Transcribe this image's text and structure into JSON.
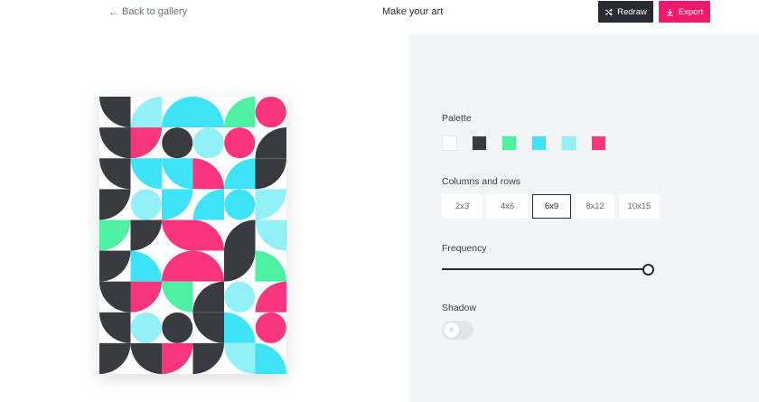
{
  "header": {
    "back_label": "Back to gallery",
    "title": "Make your art",
    "redraw_label": "Redraw",
    "export_label": "Export"
  },
  "colors": {
    "dark": "#3a3b40",
    "cyan": "#3ee3f7",
    "light_cyan": "#93f0f7",
    "pink": "#f8357d",
    "green": "#4ff0a3",
    "white": "#ffffff",
    "export_bg": "#f0196b",
    "redraw_bg": "#2a2b30"
  },
  "panel": {
    "palette_label": "Palette",
    "palette": [
      {
        "name": "white",
        "color": "#ffffff"
      },
      {
        "name": "dark",
        "color": "#3a3b40"
      },
      {
        "name": "green",
        "color": "#4ff0a3"
      },
      {
        "name": "cyan",
        "color": "#3ee3f7"
      },
      {
        "name": "light-cyan",
        "color": "#93f0f7"
      },
      {
        "name": "pink",
        "color": "#f8357d"
      }
    ],
    "grid_label": "Columns and rows",
    "grid_options": [
      {
        "label": "2x3",
        "active": false
      },
      {
        "label": "4x6",
        "active": false
      },
      {
        "label": "6x9",
        "active": true
      },
      {
        "label": "8x12",
        "active": false
      },
      {
        "label": "10x15",
        "active": false
      }
    ],
    "frequency_label": "Frequency",
    "frequency_value": 1.0,
    "shadow_label": "Shadow",
    "shadow_on": false
  },
  "artwork": {
    "columns": 6,
    "rows": 9,
    "tiles": [
      [
        {
          "bg": "white",
          "fg": "dark",
          "s": "q",
          "r": 1
        },
        {
          "bg": "white",
          "fg": "light_cyan",
          "s": "q",
          "r": 2
        },
        {
          "bg": "white",
          "fg": "cyan",
          "s": "q",
          "r": 2
        },
        {
          "bg": "white",
          "fg": "cyan",
          "s": "q",
          "r": 3
        },
        {
          "bg": "white",
          "fg": "green",
          "s": "q",
          "r": 2
        },
        {
          "bg": "white",
          "fg": "pink",
          "s": "c",
          "r": 0
        }
      ],
      [
        {
          "bg": "white",
          "fg": "dark",
          "s": "q",
          "r": 1
        },
        {
          "bg": "white",
          "fg": "pink",
          "s": "q",
          "r": 0
        },
        {
          "bg": "white",
          "fg": "dark",
          "s": "c",
          "r": 0
        },
        {
          "bg": "white",
          "fg": "light_cyan",
          "s": "c",
          "r": 0
        },
        {
          "bg": "white",
          "fg": "pink",
          "s": "c",
          "r": 0
        },
        {
          "bg": "white",
          "fg": "dark",
          "s": "q",
          "r": 2
        }
      ],
      [
        {
          "bg": "white",
          "fg": "dark",
          "s": "q",
          "r": 1
        },
        {
          "bg": "white",
          "fg": "cyan",
          "s": "q",
          "r": 1
        },
        {
          "bg": "white",
          "fg": "cyan",
          "s": "q",
          "r": 1
        },
        {
          "bg": "white",
          "fg": "pink",
          "s": "q",
          "r": 3
        },
        {
          "bg": "white",
          "fg": "cyan",
          "s": "q",
          "r": 2
        },
        {
          "bg": "white",
          "fg": "dark",
          "s": "q",
          "r": 0
        }
      ],
      [
        {
          "bg": "white",
          "fg": "dark",
          "s": "q",
          "r": 0
        },
        {
          "bg": "white",
          "fg": "light_cyan",
          "s": "c",
          "r": 0
        },
        {
          "bg": "white",
          "fg": "cyan",
          "s": "q",
          "r": 0
        },
        {
          "bg": "white",
          "fg": "cyan",
          "s": "q",
          "r": 2
        },
        {
          "bg": "white",
          "fg": "cyan",
          "s": "c",
          "r": 0
        },
        {
          "bg": "white",
          "fg": "light_cyan",
          "s": "q",
          "r": 0
        }
      ],
      [
        {
          "bg": "white",
          "fg": "green",
          "s": "q",
          "r": 0
        },
        {
          "bg": "white",
          "fg": "dark",
          "s": "q",
          "r": 0
        },
        {
          "bg": "white",
          "fg": "pink",
          "s": "q",
          "r": 1
        },
        {
          "bg": "white",
          "fg": "pink",
          "s": "q",
          "r": 3
        },
        {
          "bg": "white",
          "fg": "dark",
          "s": "q",
          "r": 2
        },
        {
          "bg": "white",
          "fg": "light_cyan",
          "s": "q",
          "r": 1
        }
      ],
      [
        {
          "bg": "white",
          "fg": "dark",
          "s": "q",
          "r": 0
        },
        {
          "bg": "white",
          "fg": "cyan",
          "s": "q",
          "r": 3
        },
        {
          "bg": "white",
          "fg": "pink",
          "s": "q",
          "r": 2
        },
        {
          "bg": "white",
          "fg": "pink",
          "s": "q",
          "r": 3
        },
        {
          "bg": "white",
          "fg": "dark",
          "s": "q",
          "r": 0
        },
        {
          "bg": "white",
          "fg": "green",
          "s": "q",
          "r": 3
        }
      ],
      [
        {
          "bg": "white",
          "fg": "dark",
          "s": "q",
          "r": 1
        },
        {
          "bg": "white",
          "fg": "pink",
          "s": "q",
          "r": 0
        },
        {
          "bg": "white",
          "fg": "green",
          "s": "q",
          "r": 1
        },
        {
          "bg": "white",
          "fg": "dark",
          "s": "q",
          "r": 2
        },
        {
          "bg": "white",
          "fg": "light_cyan",
          "s": "c",
          "r": 0
        },
        {
          "bg": "white",
          "fg": "pink",
          "s": "q",
          "r": 2
        }
      ],
      [
        {
          "bg": "white",
          "fg": "dark",
          "s": "q",
          "r": 1
        },
        {
          "bg": "white",
          "fg": "light_cyan",
          "s": "c",
          "r": 0
        },
        {
          "bg": "white",
          "fg": "dark",
          "s": "c",
          "r": 0
        },
        {
          "bg": "white",
          "fg": "dark",
          "s": "q",
          "r": 1
        },
        {
          "bg": "white",
          "fg": "cyan",
          "s": "q",
          "r": 3
        },
        {
          "bg": "white",
          "fg": "pink",
          "s": "c",
          "r": 0
        }
      ],
      [
        {
          "bg": "white",
          "fg": "dark",
          "s": "q",
          "r": 0
        },
        {
          "bg": "white",
          "fg": "dark",
          "s": "q",
          "r": 1
        },
        {
          "bg": "white",
          "fg": "pink",
          "s": "q",
          "r": 0
        },
        {
          "bg": "white",
          "fg": "dark",
          "s": "q",
          "r": 0
        },
        {
          "bg": "white",
          "fg": "light_cyan",
          "s": "q",
          "r": 1
        },
        {
          "bg": "white",
          "fg": "cyan",
          "s": "q",
          "r": 3
        }
      ]
    ]
  }
}
